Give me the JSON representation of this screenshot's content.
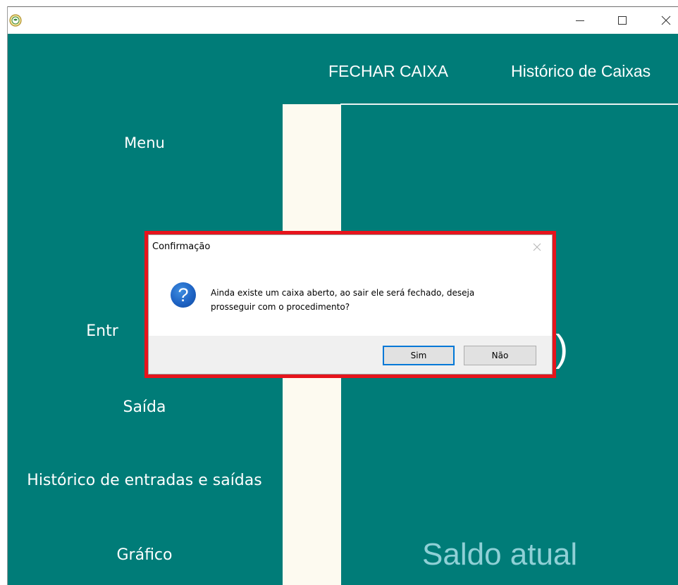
{
  "window": {
    "app_icon": "app-logo-icon",
    "controls": [
      "minimize-icon",
      "maximize-icon",
      "close-icon"
    ]
  },
  "header": {
    "fechar_caixa": "FECHAR CAIXA",
    "historico_caixas": "Histórico de Caixas"
  },
  "sidebar": {
    "title": "Menu",
    "items": [
      {
        "label": "Entr"
      },
      {
        "label": "Saída"
      },
      {
        "label": "Histórico de entradas e saídas"
      },
      {
        "label": "Gráfico"
      }
    ]
  },
  "main": {
    "value_fragment": ")",
    "saldo_label": "Saldo atual"
  },
  "dialog": {
    "title": "Confirmação",
    "icon": "question-icon",
    "icon_glyph": "?",
    "message_line1": "Ainda existe um caixa aberto, ao sair ele será fechado, deseja",
    "message_line2": "prosseguir com o procedimento?",
    "yes_label": "Sim",
    "no_label": "Não",
    "highlight_color": "#e6141c"
  },
  "colors": {
    "app_background": "#007c78",
    "cream_panel": "#fdfaf0",
    "saldo_text": "#8fd0d6"
  }
}
